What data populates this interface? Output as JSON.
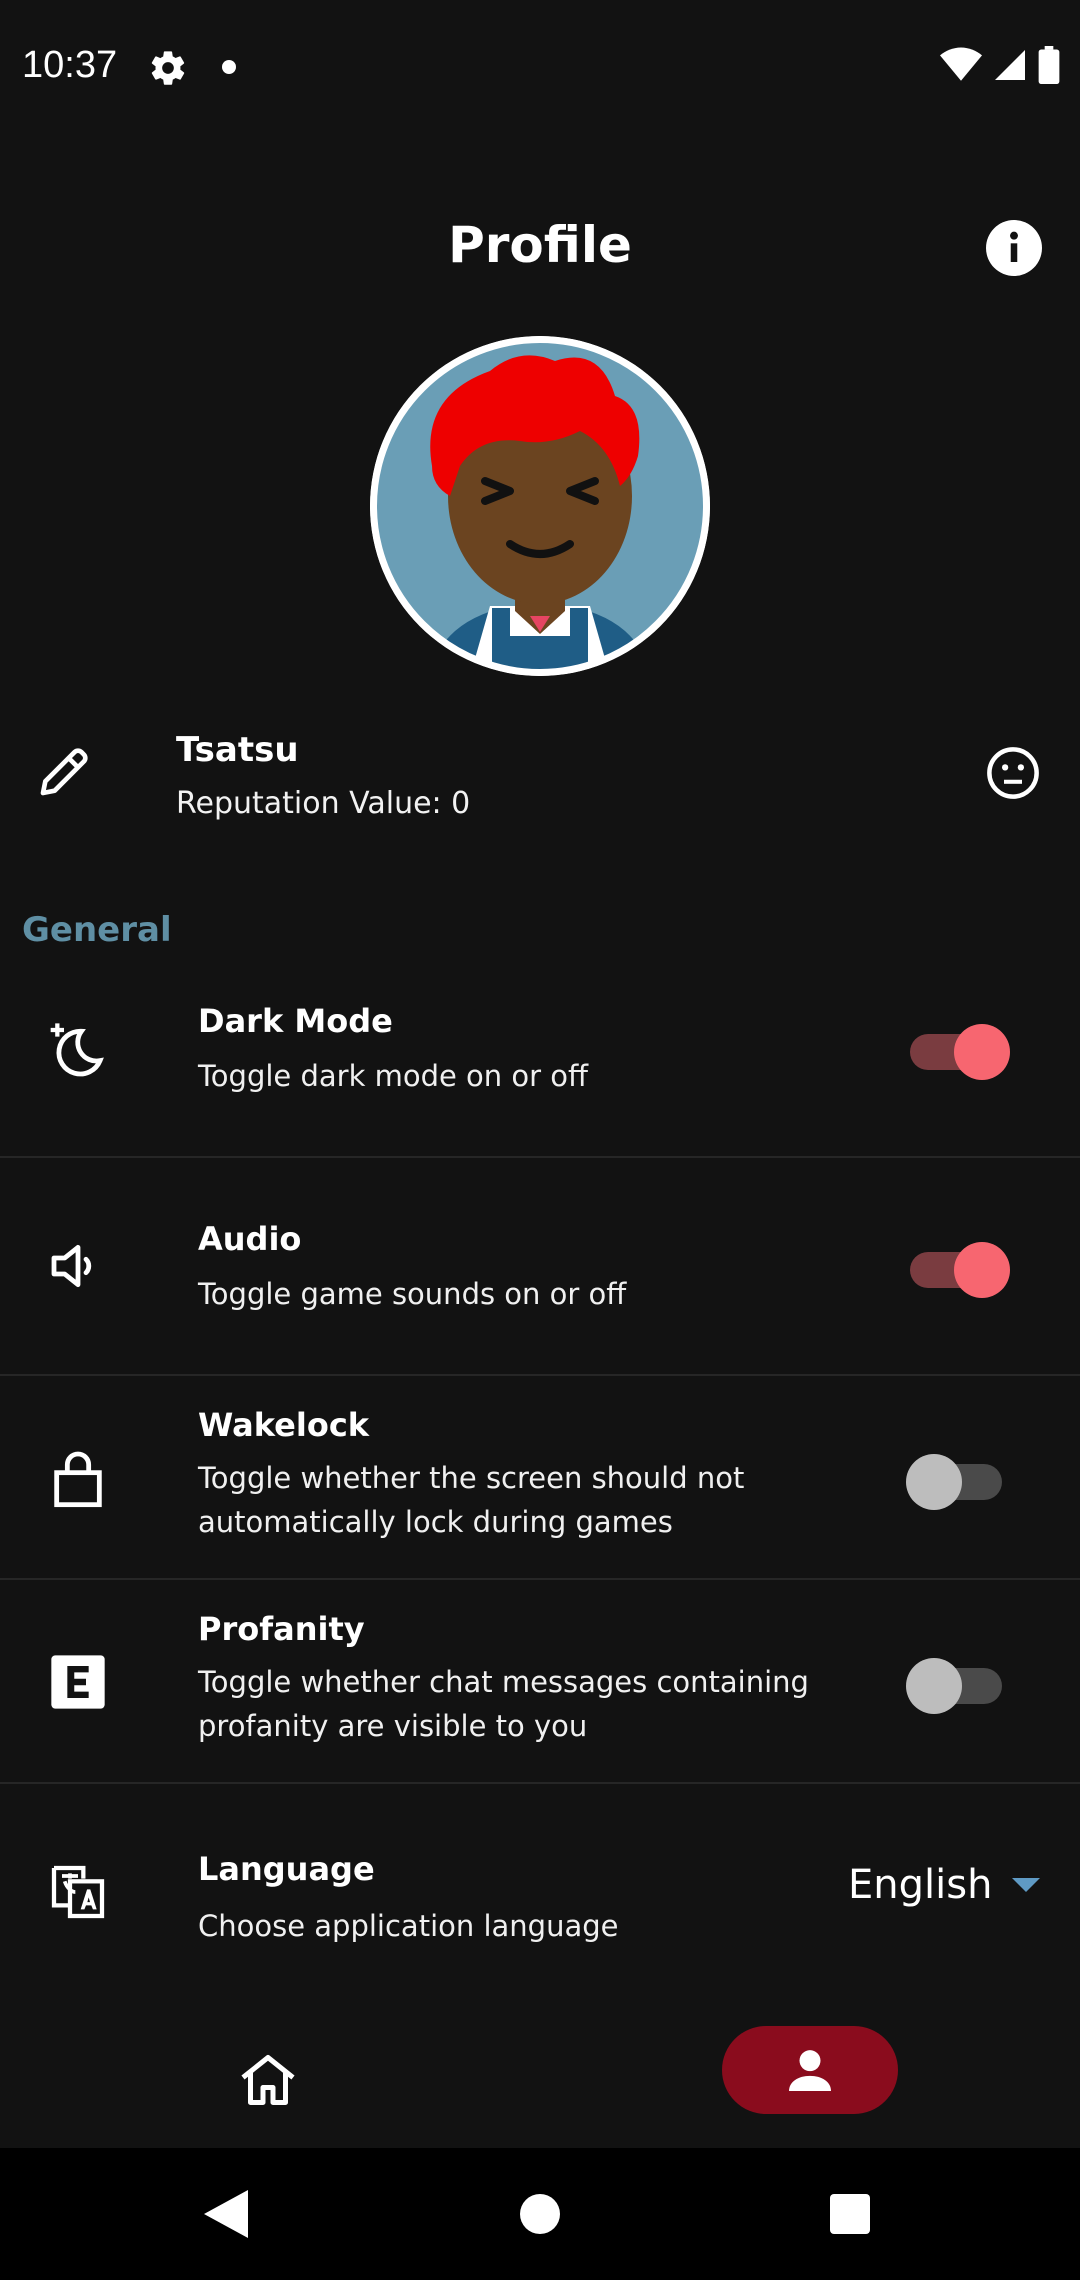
{
  "status_bar": {
    "time": "10:37",
    "icons": [
      "settings-icon",
      "notification-dot",
      "wifi-icon",
      "signal-icon",
      "battery-icon"
    ]
  },
  "header": {
    "title": "Profile",
    "info_icon": "info-icon"
  },
  "user": {
    "name": "Tsatsu",
    "reputation": "Reputation Value: 0",
    "edit_icon": "pencil-icon",
    "reputation_icon": "neutral-face-icon"
  },
  "section": {
    "label": "General"
  },
  "settings": [
    {
      "icon": "dark-mode-icon",
      "title": "Dark Mode",
      "desc": "Toggle dark mode on or off",
      "enabled": true
    },
    {
      "icon": "speaker-icon",
      "title": "Audio",
      "desc": "Toggle game sounds on or off",
      "enabled": true
    },
    {
      "icon": "lock-icon",
      "title": "Wakelock",
      "desc": "Toggle whether the screen should not automatically lock during games",
      "enabled": false
    },
    {
      "icon": "explicit-icon",
      "title": "Profanity",
      "desc": "Toggle whether chat messages containing profanity are visible to you",
      "enabled": false
    },
    {
      "icon": "translate-icon",
      "title": "Language",
      "desc": "Choose application language",
      "selected_value": "English"
    }
  ],
  "bottom_nav": {
    "items": [
      {
        "icon": "home-icon",
        "active": false
      },
      {
        "icon": "person-icon",
        "active": true
      }
    ]
  },
  "colors": {
    "background": "#121212",
    "accent_section": "#5f8fa4",
    "toggle_on_thumb": "#f76670",
    "toggle_on_track": "#7a3c40",
    "nav_active": "#8a0c1d",
    "caret": "#5f9ac4"
  }
}
